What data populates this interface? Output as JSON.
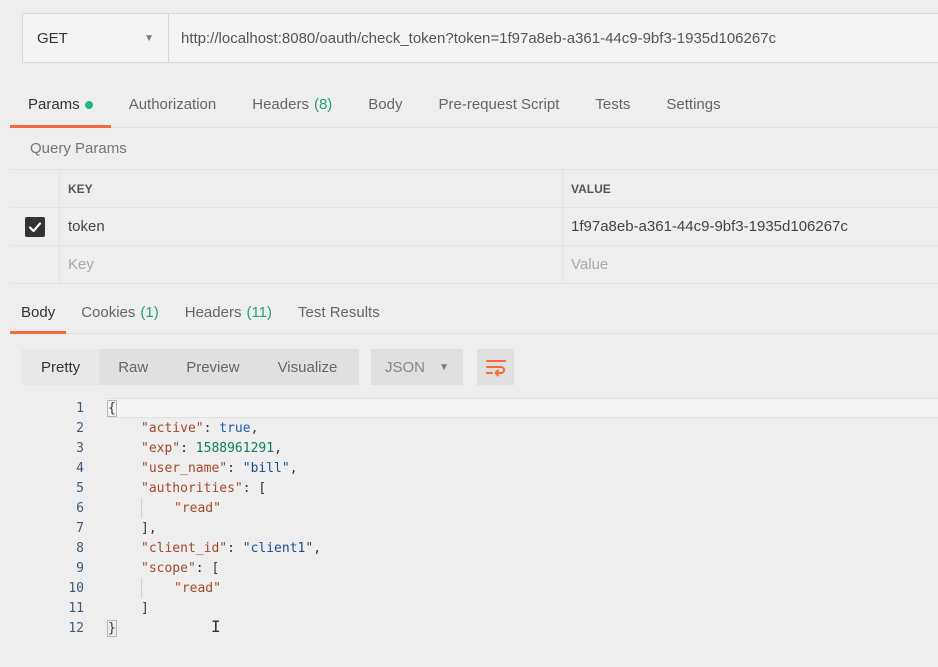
{
  "request": {
    "method": "GET",
    "url": "http://localhost:8080/oauth/check_token?token=1f97a8eb-a361-44c9-9bf3-1935d106267c"
  },
  "request_tabs": [
    {
      "label": "Params",
      "active": true,
      "indicator": "dot"
    },
    {
      "label": "Authorization"
    },
    {
      "label": "Headers",
      "count": "(8)"
    },
    {
      "label": "Body"
    },
    {
      "label": "Pre-request Script"
    },
    {
      "label": "Tests"
    },
    {
      "label": "Settings"
    }
  ],
  "query_params": {
    "title": "Query Params",
    "headers": {
      "key": "KEY",
      "value": "VALUE"
    },
    "rows": [
      {
        "checked": true,
        "key": "token",
        "value": "1f97a8eb-a361-44c9-9bf3-1935d106267c"
      }
    ],
    "placeholder": {
      "key": "Key",
      "value": "Value"
    }
  },
  "response_tabs": [
    {
      "label": "Body",
      "active": true
    },
    {
      "label": "Cookies",
      "count": "(1)"
    },
    {
      "label": "Headers",
      "count": "(11)"
    },
    {
      "label": "Test Results"
    }
  ],
  "view_modes": [
    "Pretty",
    "Raw",
    "Preview",
    "Visualize"
  ],
  "active_view": "Pretty",
  "format": "JSON",
  "icons": {
    "wrap": "wrap-lines-icon",
    "check": "check-icon",
    "dropdown": "chevron-down-icon"
  },
  "colors": {
    "accent": "#f26b3a",
    "success": "#26b47f"
  },
  "response_body": {
    "lines": [
      {
        "n": "1",
        "indent": 0,
        "parts": [
          {
            "t": "{",
            "c": "punc"
          }
        ]
      },
      {
        "n": "2",
        "indent": 1,
        "parts": [
          {
            "t": "\"active\"",
            "c": "key"
          },
          {
            "t": ": ",
            "c": "punc"
          },
          {
            "t": "true",
            "c": "bool"
          },
          {
            "t": ",",
            "c": "punc"
          }
        ]
      },
      {
        "n": "3",
        "indent": 1,
        "parts": [
          {
            "t": "\"exp\"",
            "c": "key"
          },
          {
            "t": ": ",
            "c": "punc"
          },
          {
            "t": "1588961291",
            "c": "num"
          },
          {
            "t": ",",
            "c": "punc"
          }
        ]
      },
      {
        "n": "4",
        "indent": 1,
        "parts": [
          {
            "t": "\"user_name\"",
            "c": "key"
          },
          {
            "t": ": ",
            "c": "punc"
          },
          {
            "t": "\"bill\"",
            "c": "str"
          },
          {
            "t": ",",
            "c": "punc"
          }
        ]
      },
      {
        "n": "5",
        "indent": 1,
        "parts": [
          {
            "t": "\"authorities\"",
            "c": "key"
          },
          {
            "t": ": [",
            "c": "punc"
          }
        ]
      },
      {
        "n": "6",
        "indent": 2,
        "parts": [
          {
            "t": "\"read\"",
            "c": "key"
          }
        ]
      },
      {
        "n": "7",
        "indent": 1,
        "parts": [
          {
            "t": "],",
            "c": "punc"
          }
        ]
      },
      {
        "n": "8",
        "indent": 1,
        "parts": [
          {
            "t": "\"client_id\"",
            "c": "key"
          },
          {
            "t": ": ",
            "c": "punc"
          },
          {
            "t": "\"client1\"",
            "c": "str"
          },
          {
            "t": ",",
            "c": "punc"
          }
        ]
      },
      {
        "n": "9",
        "indent": 1,
        "parts": [
          {
            "t": "\"scope\"",
            "c": "key"
          },
          {
            "t": ": [",
            "c": "punc"
          }
        ]
      },
      {
        "n": "10",
        "indent": 2,
        "parts": [
          {
            "t": "\"read\"",
            "c": "key"
          }
        ]
      },
      {
        "n": "11",
        "indent": 1,
        "parts": [
          {
            "t": "]",
            "c": "punc"
          }
        ]
      },
      {
        "n": "12",
        "indent": 0,
        "parts": [
          {
            "t": "}",
            "c": "punc"
          }
        ]
      }
    ]
  }
}
